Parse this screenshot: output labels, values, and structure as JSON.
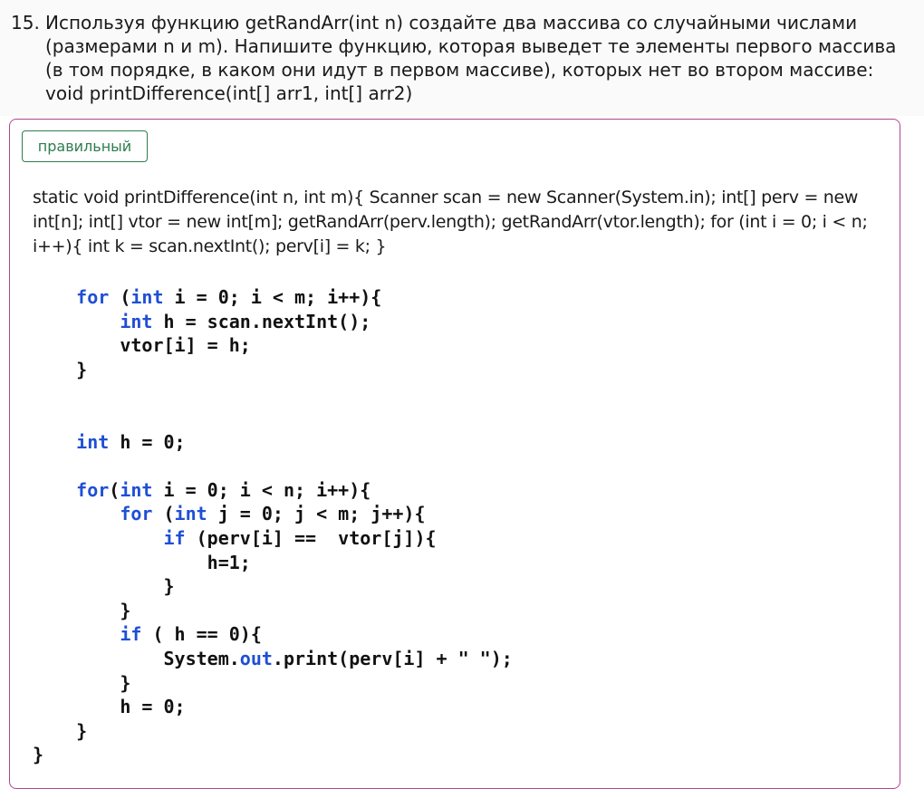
{
  "question": {
    "number": "15.",
    "text": "Используя функцию getRandArr(int n) создайте два массива со случайными числами (размерами n и m). Напишите функцию, которая выведет те элементы первого массива (в том порядке, в каком они идут в первом массиве), которых нет во втором массиве: void printDifference(int[] arr1, int[] arr2)"
  },
  "answer": {
    "status_label": "правильный",
    "intro_text": "static void printDifference(int n, int m){ Scanner scan = new Scanner(System.in); int[] perv = new int[n]; int[] vtor = new int[m]; getRandArr(perv.length); getRandArr(vtor.length); for (int i = 0; i < n; i++){ int k = scan.nextInt(); perv[i] = k; }",
    "code_lines": [
      "    for (int i = 0; i < m; i++){",
      "        int h = scan.nextInt();",
      "        vtor[i] = h;",
      "    }",
      "",
      "",
      "    int h = 0;",
      "",
      "    for(int i = 0; i < n; i++){",
      "        for (int j = 0; j < m; j++){",
      "            if (perv[i] ==  vtor[j]){",
      "                h=1;",
      "            }",
      "        }",
      "        if ( h == 0){",
      "            System.out.print(perv[i] + \" \");",
      "        }",
      "        h = 0;",
      "    }",
      "}"
    ]
  },
  "colors": {
    "keyword": "#1f4fd6",
    "status": "#2e7d4f",
    "card_border": "#b0468f"
  }
}
